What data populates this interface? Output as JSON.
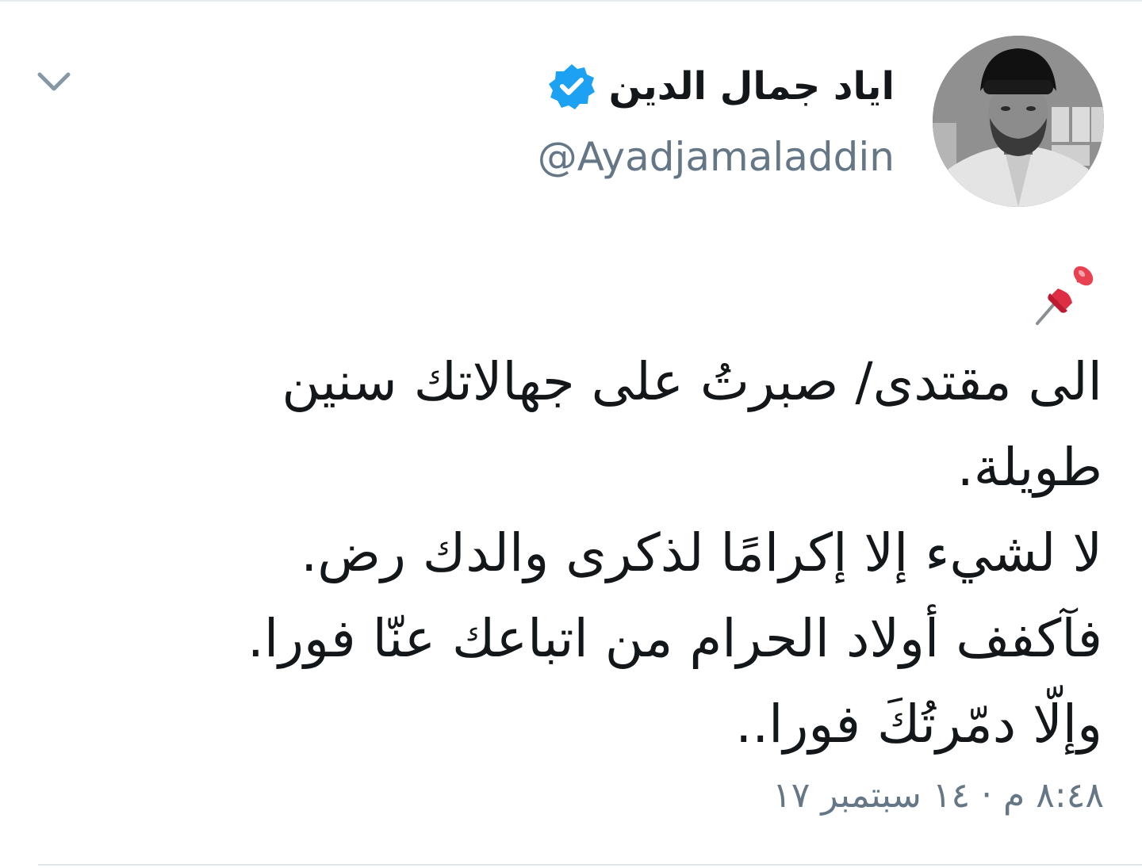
{
  "author": {
    "display_name": "اياد جمال الدين",
    "handle": "@Ayadjamaladdin",
    "verified": true,
    "avatar_icon": "user-avatar-photo"
  },
  "tweet": {
    "pin_icon": "pushpin-emoji",
    "lines": [
      "الى مقتدى/ صبرتُ على جهالاتك سنين",
      "طويلة.",
      "لا لشيء إلا إكرامًا لذكرى والدك رض.",
      "فآكفف أولاد الحرام من اتباعك عنّا فورا.",
      "وإلّا دمّرتُكَ فورا.."
    ],
    "timestamp": "٨:٤٨ م · ١٤ سبتمبر ١٧"
  },
  "menu": {
    "caret_icon": "chevron-down-icon"
  },
  "colors": {
    "text_primary": "#14171a",
    "text_secondary": "#657786",
    "verified_blue": "#1da1f2",
    "divider": "#e1e8ed"
  }
}
